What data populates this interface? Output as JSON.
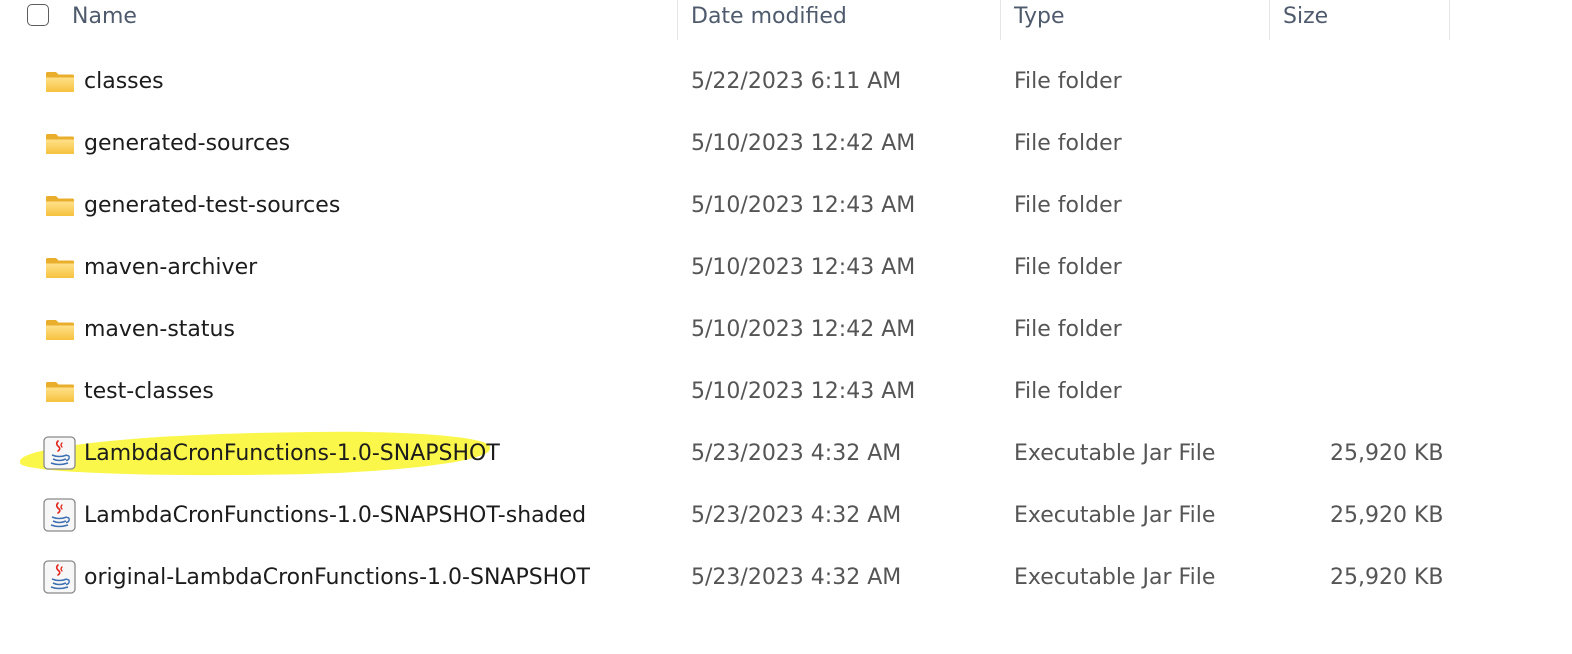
{
  "header": {
    "name": "Name",
    "date": "Date modified",
    "type": "Type",
    "size": "Size"
  },
  "accent": {
    "highlight": "#fbf74a",
    "folder": "#f8c944"
  },
  "files": [
    {
      "name": "classes",
      "date": "5/22/2023 6:11 AM",
      "type": "File folder",
      "size": "",
      "icon": "folder-icon"
    },
    {
      "name": "generated-sources",
      "date": "5/10/2023 12:42 AM",
      "type": "File folder",
      "size": "",
      "icon": "folder-icon"
    },
    {
      "name": "generated-test-sources",
      "date": "5/10/2023 12:43 AM",
      "type": "File folder",
      "size": "",
      "icon": "folder-icon"
    },
    {
      "name": "maven-archiver",
      "date": "5/10/2023 12:43 AM",
      "type": "File folder",
      "size": "",
      "icon": "folder-icon"
    },
    {
      "name": "maven-status",
      "date": "5/10/2023 12:42 AM",
      "type": "File folder",
      "size": "",
      "icon": "folder-icon"
    },
    {
      "name": "test-classes",
      "date": "5/10/2023 12:43 AM",
      "type": "File folder",
      "size": "",
      "icon": "folder-icon"
    },
    {
      "name": "LambdaCronFunctions-1.0-SNAPSHOT",
      "date": "5/23/2023 4:32 AM",
      "type": "Executable Jar File",
      "size": "25,920 KB",
      "icon": "java-jar-icon"
    },
    {
      "name": "LambdaCronFunctions-1.0-SNAPSHOT-shaded",
      "date": "5/23/2023 4:32 AM",
      "type": "Executable Jar File",
      "size": "25,920 KB",
      "icon": "java-jar-icon"
    },
    {
      "name": "original-LambdaCronFunctions-1.0-SNAPSHOT",
      "date": "5/23/2023 4:32 AM",
      "type": "Executable Jar File",
      "size": "25,920 KB",
      "icon": "java-jar-icon"
    }
  ]
}
